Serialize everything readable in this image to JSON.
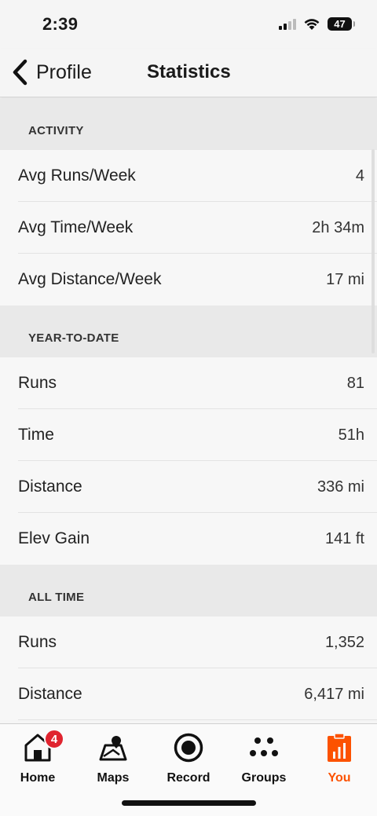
{
  "status": {
    "time": "2:39",
    "battery": "47"
  },
  "nav": {
    "back_label": "Profile",
    "title": "Statistics"
  },
  "sections": {
    "activity": {
      "title": "ACTIVITY",
      "rows": [
        {
          "label": "Avg Runs/Week",
          "value": "4"
        },
        {
          "label": "Avg Time/Week",
          "value": "2h 34m"
        },
        {
          "label": "Avg Distance/Week",
          "value": "17 mi"
        }
      ]
    },
    "ytd": {
      "title": "YEAR-TO-DATE",
      "rows": [
        {
          "label": "Runs",
          "value": "81"
        },
        {
          "label": "Time",
          "value": "51h"
        },
        {
          "label": "Distance",
          "value": "336 mi"
        },
        {
          "label": "Elev Gain",
          "value": "141 ft"
        }
      ]
    },
    "alltime": {
      "title": "ALL TIME",
      "rows": [
        {
          "label": "Runs",
          "value": "1,352"
        },
        {
          "label": "Distance",
          "value": "6,417 mi"
        }
      ]
    }
  },
  "tabbar": {
    "home": {
      "label": "Home",
      "badge": "4",
      "icon": "home-icon"
    },
    "maps": {
      "label": "Maps",
      "icon": "maps-icon"
    },
    "record": {
      "label": "Record",
      "icon": "record-icon"
    },
    "groups": {
      "label": "Groups",
      "icon": "groups-icon"
    },
    "you": {
      "label": "You",
      "icon": "you-icon"
    }
  },
  "colors": {
    "accent": "#fc5200",
    "badge": "#e0242f"
  }
}
